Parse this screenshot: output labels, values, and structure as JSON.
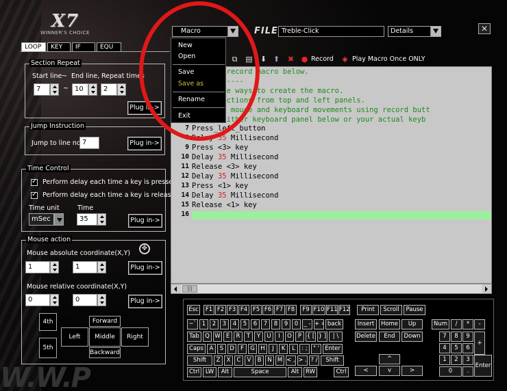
{
  "logo": {
    "brand": "X7",
    "tagline": "WINNER'S CHOICE"
  },
  "tabs": [
    "LOOP",
    "KEY",
    "IF",
    "EQU"
  ],
  "section_repeat": {
    "title": "Section Repeat",
    "start_label": "Start line",
    "sep1": "~",
    "end_label": "End line,",
    "repeat_label": "Repeat times",
    "start": "7",
    "tilde": "~",
    "end": "10",
    "repeat": "2",
    "button": "Plug in->"
  },
  "jump": {
    "title": "Jump Instruction",
    "label": "Jump to line no:",
    "value": "7",
    "button": "Plug in->"
  },
  "time_control": {
    "title": "Time Control",
    "chk1": "Perform delay each time a key is pressed",
    "chk2": "Perform delay each time a key is released",
    "unit_label": "Time unit",
    "time_label": "Time",
    "unit": "mSec",
    "time": "35",
    "button": "Plug in->"
  },
  "mouse_action": {
    "title": "Mouse action",
    "abs_label": "Mouse absolute coordinate(X,Y)",
    "abs_x": "1",
    "abs_y": "1",
    "abs_button": "Plug in->",
    "rel_label": "Mouse relative coordinate(X,Y)",
    "rel_x": "0",
    "rel_y": "0",
    "rel_button": "Plug in->",
    "b4": "4th",
    "b5": "5th",
    "forward": "Forward",
    "left": "Left",
    "middle": "Middle",
    "right": "Right",
    "backward": "Backward",
    "crosshair": "✥"
  },
  "topbar": {
    "macro_combo": "Macro",
    "file_label": "FILE",
    "filename": "Treble-Click",
    "details_combo": "Details",
    "close": "✕"
  },
  "menu": {
    "items": [
      "New",
      "Open",
      "Save",
      "Save as",
      "Rename",
      "Exit"
    ]
  },
  "toolbar": {
    "record": "Record",
    "play": "Play Macro Once ONLY"
  },
  "editor": {
    "lines": [
      {
        "n": "",
        "t": "is your record macro below."
      },
      {
        "n": "",
        "t": "------------"
      },
      {
        "n": "",
        "t": "are three ways to create the macro."
      },
      {
        "n": "",
        "t": "sert functions from top and left panels."
      },
      {
        "n": "",
        "t": "ord both mouse and keyboard movements using record butt"
      },
      {
        "n": "",
        "t": "t with either keyboard panel below or your actual keyb"
      },
      {
        "n": "7",
        "t": "Press_left_button"
      },
      {
        "n": "8",
        "t": "Delay ",
        "v": "35",
        "u": " Millisecond"
      },
      {
        "n": "9",
        "t": "Press <3> key"
      },
      {
        "n": "10",
        "t": "Delay ",
        "v": "35",
        "u": " Millisecond"
      },
      {
        "n": "11",
        "t": "Release <3> key"
      },
      {
        "n": "12",
        "t": "Delay ",
        "v": "35",
        "u": " Millisecond"
      },
      {
        "n": "13",
        "t": "Press <1> key"
      },
      {
        "n": "14",
        "t": "Delay ",
        "v": "35",
        "u": " Millisecond"
      },
      {
        "n": "15",
        "t": "Release <1> key"
      },
      {
        "n": "16",
        "t": ""
      }
    ],
    "scroll_thumb": "|||"
  },
  "keyboard": {
    "f_row": [
      "Esc",
      "F1",
      "F2",
      "F3",
      "F4",
      "F5",
      "F6",
      "F7",
      "F8",
      "F9",
      "F10",
      "F11",
      "F12"
    ],
    "sys": [
      "Print",
      "Scroll",
      "Pause"
    ],
    "num_row": [
      "~`",
      "1",
      "2",
      "3",
      "4",
      "5",
      "6",
      "7",
      "8",
      "9",
      "0",
      "_ -",
      "+ =",
      "back"
    ],
    "tab_row": [
      "Tab",
      "Q",
      "W",
      "E",
      "R",
      "T",
      "Y",
      "U",
      "I",
      "O",
      "P",
      "{ [",
      "} ]",
      "| \\"
    ],
    "caps_row": [
      "Caps",
      "A",
      "S",
      "D",
      "F",
      "G",
      "H",
      "J",
      "K",
      "L",
      ": ;",
      "\" '",
      "Enter"
    ],
    "shift_row": [
      "Shift",
      "Z",
      "X",
      "C",
      "V",
      "B",
      "N",
      "M",
      "< ,",
      "> .",
      "? /",
      "Shift"
    ],
    "ctrl_row": [
      "Ctrl",
      "LW",
      "Alt",
      "Space",
      "Alt",
      "RW",
      "Ctrl"
    ],
    "nav": [
      "Insert",
      "Home",
      "Up",
      "Delete",
      "End",
      "Down"
    ],
    "arrows": [
      "^",
      "<",
      "v",
      ">"
    ],
    "numpad": [
      "Num",
      "/",
      "*",
      "-",
      "7",
      "8",
      "9",
      "+",
      "4",
      "5",
      "6",
      "1",
      "2",
      "3",
      "Enter",
      "0",
      "."
    ]
  }
}
